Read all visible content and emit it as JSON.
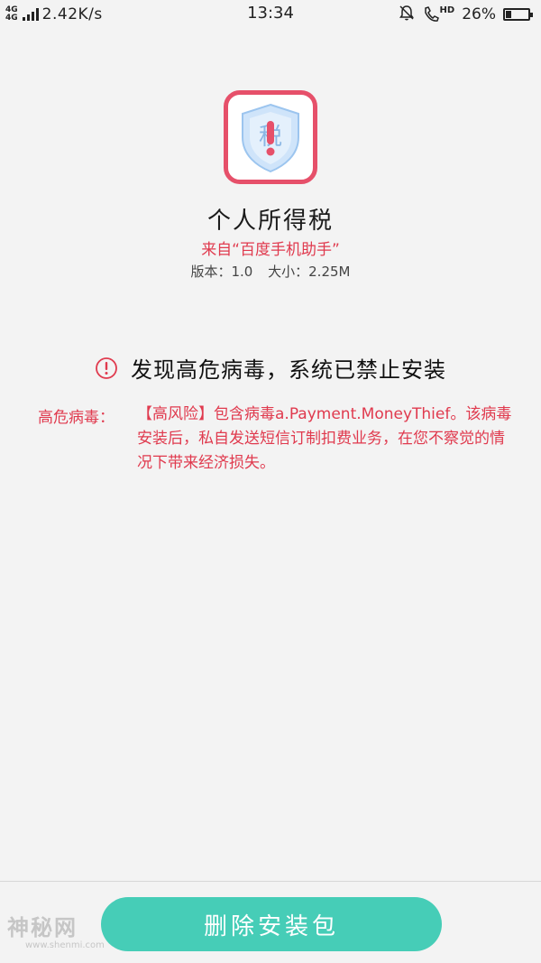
{
  "status_bar": {
    "network_tag_top": "4G",
    "network_tag_bottom": "4G",
    "speed": "2.42K/s",
    "time": "13:34",
    "hd_label": "HD",
    "battery_percent": "26%",
    "battery_level": 0.26
  },
  "app": {
    "icon_glyph": "税",
    "name": "个人所得税",
    "source": "来自“百度手机助手”",
    "version": "版本：1.0",
    "size": "大小：2.25M"
  },
  "warning": {
    "title": "发现高危病毒，系统已禁止安装",
    "detail_label": "高危病毒：",
    "detail_text": "【高风险】包含病毒a.Payment.MoneyThief。该病毒安装后，私自发送短信订制扣费业务，在您不察觉的情况下带来经济损失。"
  },
  "actions": {
    "delete_label": "删除安装包"
  },
  "watermark": {
    "main": "神秘网",
    "sub": "www.shenmi.com"
  },
  "colors": {
    "accent_red": "#e03a4e",
    "icon_border": "#e6506a",
    "button_teal": "#46cdb7"
  }
}
